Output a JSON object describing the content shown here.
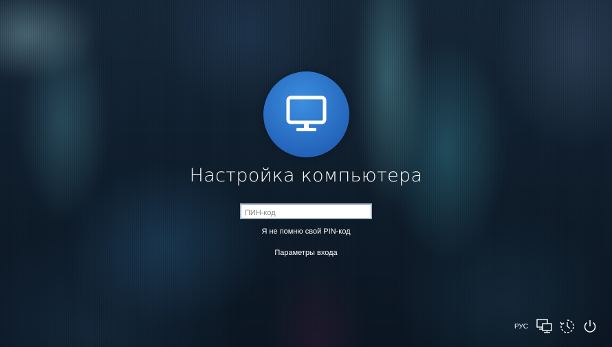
{
  "avatar": {
    "icon": "monitor-icon",
    "color": "#2f7ad6"
  },
  "user": {
    "name": "Настройка компьютера"
  },
  "pin": {
    "placeholder": "ПИН-код",
    "value": ""
  },
  "links": {
    "forgot_pin": "Я не помню свой PIN-код",
    "signin_options": "Параметры входа"
  },
  "tray": {
    "language": "РУС",
    "icons": [
      "network-icon",
      "accessibility-icon",
      "power-icon"
    ]
  }
}
